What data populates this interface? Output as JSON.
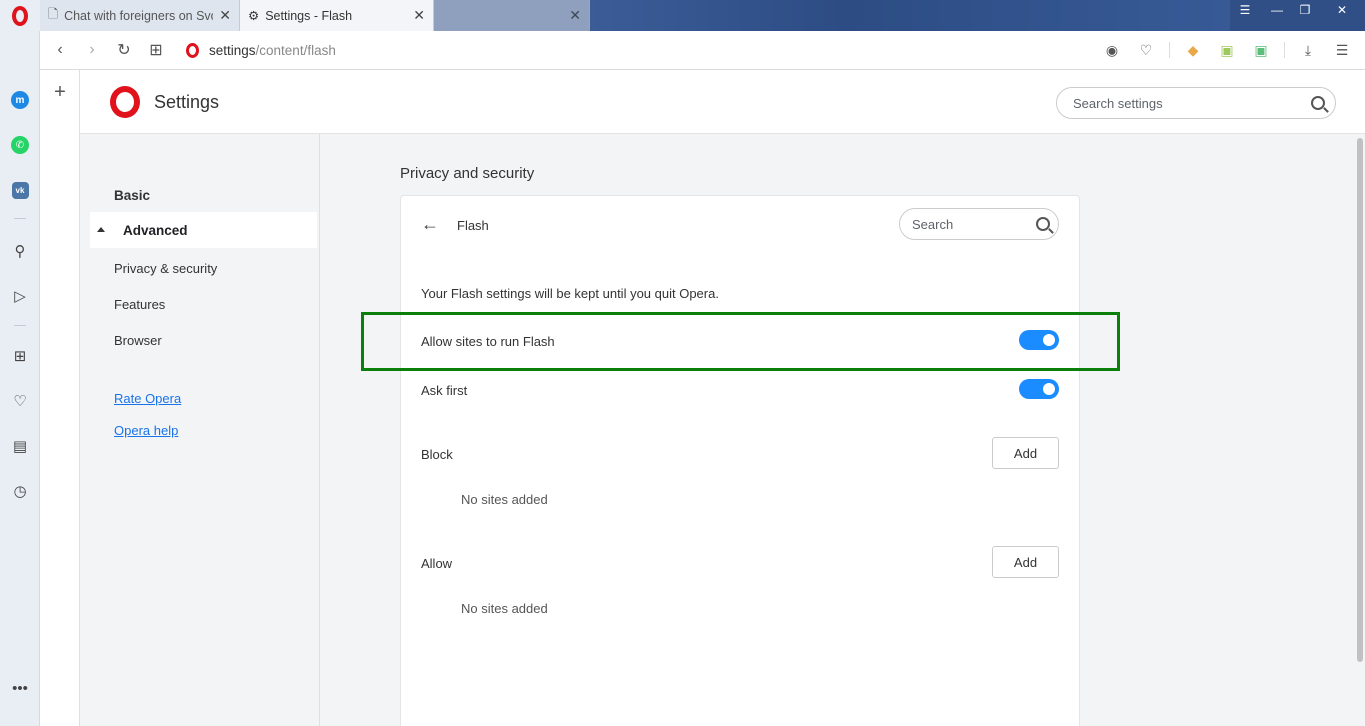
{
  "tabs": [
    {
      "title": "Chat with foreigners on Svo",
      "icon": "document-icon"
    },
    {
      "title": "Settings - Flash",
      "icon": "gear-icon"
    }
  ],
  "address": {
    "host": "settings",
    "path": "/content/flash"
  },
  "settings": {
    "title": "Settings",
    "search_placeholder": "Search settings"
  },
  "nav": {
    "basic": "Basic",
    "advanced": "Advanced",
    "privacy": "Privacy & security",
    "features": "Features",
    "browser": "Browser",
    "rate": "Rate Opera",
    "help": "Opera help"
  },
  "main": {
    "section_title": "Privacy and security",
    "page_title": "Flash",
    "search_placeholder": "Search",
    "info": "Your Flash settings will be kept until you quit Opera.",
    "allow_flash": {
      "label": "Allow sites to run Flash",
      "enabled": true
    },
    "ask_first": {
      "label": "Ask first",
      "enabled": true
    },
    "block": {
      "label": "Block",
      "add": "Add",
      "empty": "No sites added"
    },
    "allow": {
      "label": "Allow",
      "add": "Add",
      "empty": "No sites added"
    }
  },
  "colors": {
    "accent": "#1a8cff",
    "highlight": "#0a7f0a",
    "opera_red": "#e0121c"
  }
}
